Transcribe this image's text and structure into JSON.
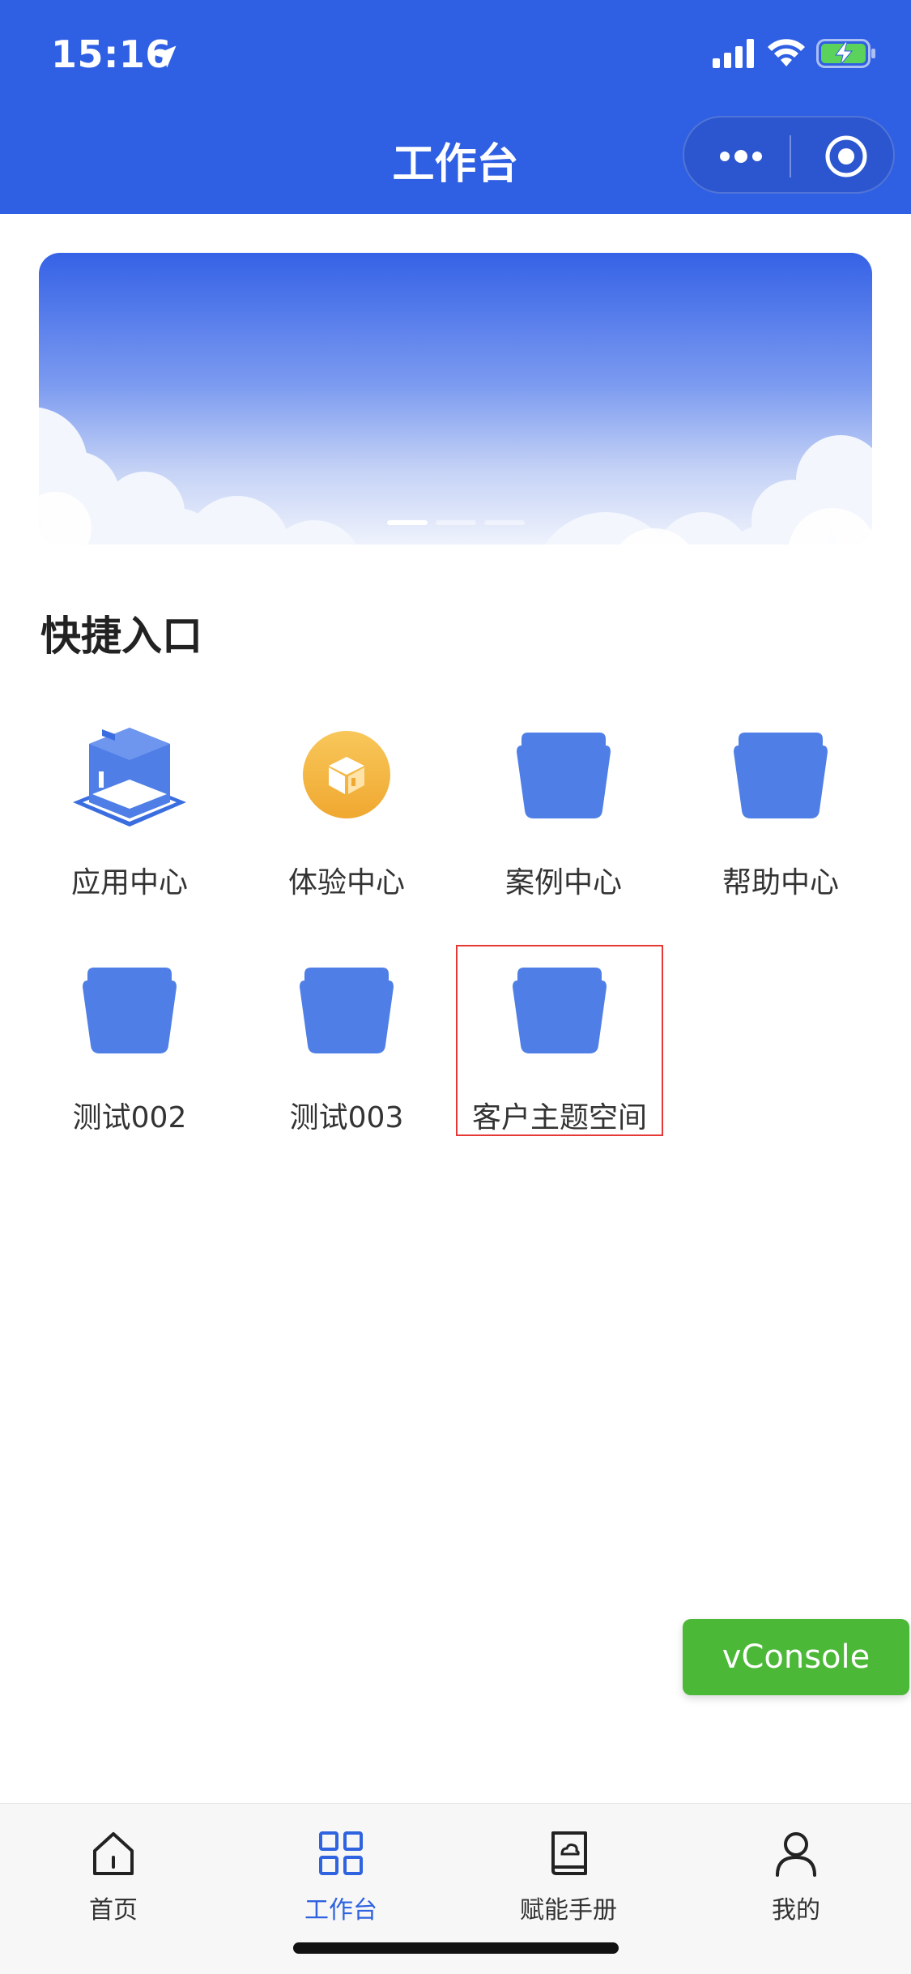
{
  "status_bar": {
    "time": "15:16"
  },
  "nav": {
    "title": "工作台"
  },
  "banner": {
    "pages": 3,
    "active_page": 1
  },
  "section": {
    "title": "快捷入口"
  },
  "shortcuts": [
    {
      "label": "应用中心",
      "icon": "app-center-icon"
    },
    {
      "label": "体验中心",
      "icon": "experience-cube-icon"
    },
    {
      "label": "案例中心",
      "icon": "folder-icon"
    },
    {
      "label": "帮助中心",
      "icon": "folder-icon"
    },
    {
      "label": "测试002",
      "icon": "folder-icon"
    },
    {
      "label": "测试003",
      "icon": "folder-icon"
    },
    {
      "label": "客户主题空间",
      "icon": "folder-icon",
      "selected": true
    }
  ],
  "vconsole": {
    "label": "vConsole"
  },
  "tabbar": {
    "items": [
      {
        "label": "首页",
        "icon": "home-icon"
      },
      {
        "label": "工作台",
        "icon": "grid-icon",
        "active": true
      },
      {
        "label": "赋能手册",
        "icon": "book-icon"
      },
      {
        "label": "我的",
        "icon": "user-icon"
      }
    ]
  },
  "colors": {
    "primary": "#2f5fe3",
    "folder": "#4f7fe6",
    "accent_active": "#2f63e0",
    "vconsole": "#4cb838",
    "selection": "#e53935"
  }
}
